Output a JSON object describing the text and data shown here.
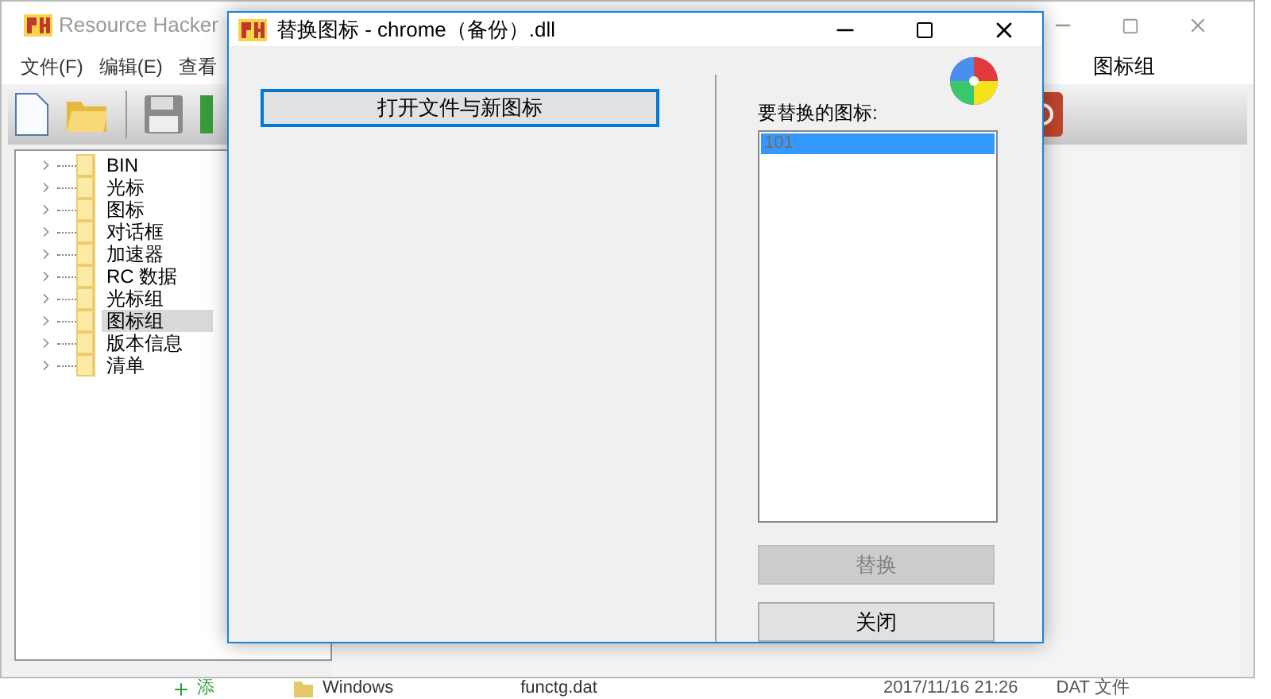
{
  "background_window": {
    "title": "Resource Hacker",
    "menu": [
      "文件(F)",
      "编辑(E)",
      "查看"
    ],
    "pane_header": "图标组",
    "tree": [
      {
        "label": "BIN",
        "selected": false
      },
      {
        "label": "光标",
        "selected": false
      },
      {
        "label": "图标",
        "selected": false
      },
      {
        "label": "对话框",
        "selected": false
      },
      {
        "label": "加速器",
        "selected": false
      },
      {
        "label": "RC 数据",
        "selected": false
      },
      {
        "label": "光标组",
        "selected": false
      },
      {
        "label": "图标组",
        "selected": true
      },
      {
        "label": "版本信息",
        "selected": false
      },
      {
        "label": "清单",
        "selected": false
      }
    ]
  },
  "dialog": {
    "title": "替换图标 - chrome（备份）.dll",
    "open_button": "打开文件与新图标",
    "list_label": "要替换的图标:",
    "icon_list": [
      {
        "label": "101",
        "selected": true
      }
    ],
    "buttons": [
      {
        "label": "替换",
        "disabled": true
      },
      {
        "label": "关闭",
        "disabled": false
      }
    ]
  },
  "explorer_strip": {
    "add_label": "添",
    "folder": "Windows",
    "file": "functg.dat",
    "modified": "2017/11/16 21:26",
    "type": "DAT 文件"
  }
}
